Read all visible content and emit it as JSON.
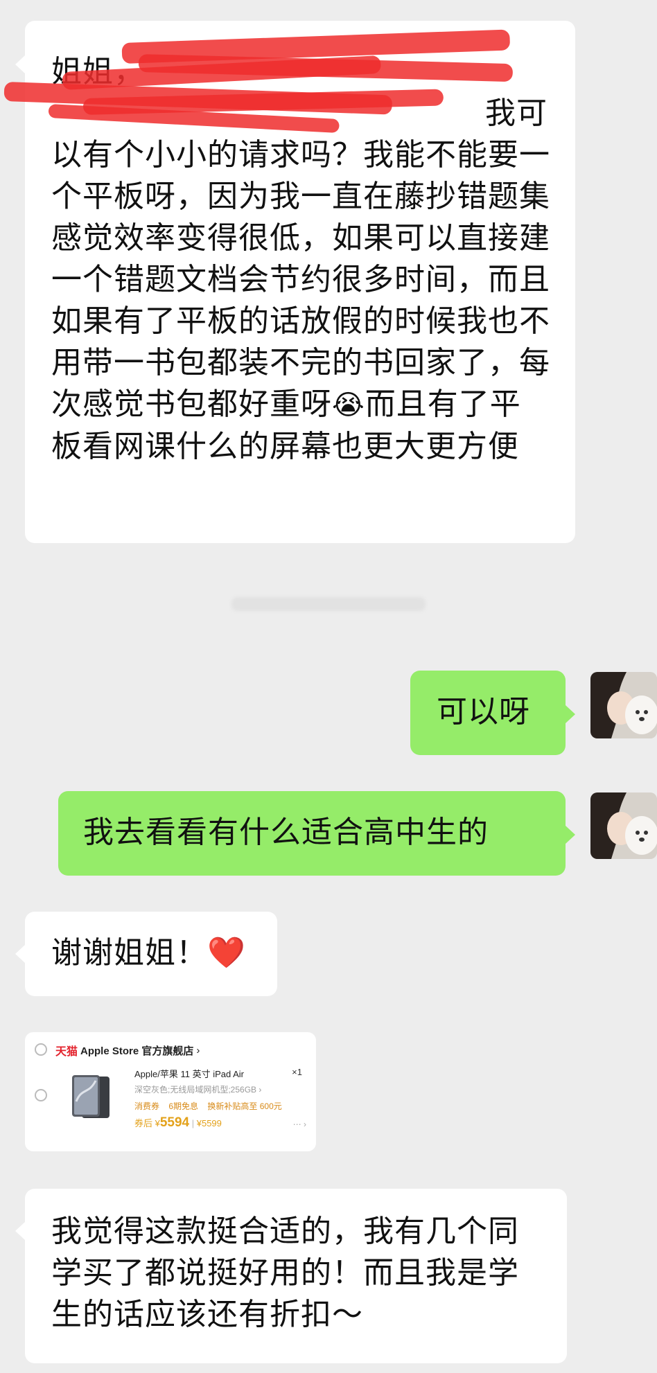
{
  "messages": {
    "m1": {
      "line1_visible": "姐姐，",
      "line2_tail": "我可",
      "body": "以有个小小的请求吗？我能不能要一个平板呀，因为我一直在藤抄错题集感觉效率变得很低，如果可以直接建一个错题文档会节约很多时间，而且如果有了平板的话放假的时候我也不用带一书包都装不完的书回家了，每次感觉书包都好重呀",
      "emoji": "😭",
      "after_emoji": "而且有了平板看网课什么的屏幕也更大更方便"
    },
    "m2": {
      "text": "可以呀"
    },
    "m3": {
      "text": "我去看看有什么适合高中生的"
    },
    "m4": {
      "text": "谢谢姐姐！",
      "emoji": "❤️"
    },
    "m6": {
      "text": "我觉得这款挺合适的，我有几个同学买了都说挺好用的！而且我是学生的话应该还有折扣～"
    }
  },
  "product_card": {
    "platform": "天猫",
    "store_name": "Apple Store 官方旗舰店",
    "store_chevron": "›",
    "title": "Apple/苹果 11 英寸 iPad Air",
    "quantity": "×1",
    "variant": "深空灰色;无线局域网机型;256GB ›",
    "promos": [
      "消费券",
      "6期免息",
      "换新补贴高至 600元"
    ],
    "price_prefix": "券后 ¥",
    "price_after": "5594",
    "price_sep": " | ",
    "price_original": "¥5599",
    "more": "⋯ ›"
  },
  "colors": {
    "background": "#ededed",
    "incoming_bubble": "#ffffff",
    "outgoing_bubble": "#95ec69",
    "redaction": "#ef2d2d",
    "tmall_red": "#e3222c",
    "price_orange": "#e3a11a"
  }
}
